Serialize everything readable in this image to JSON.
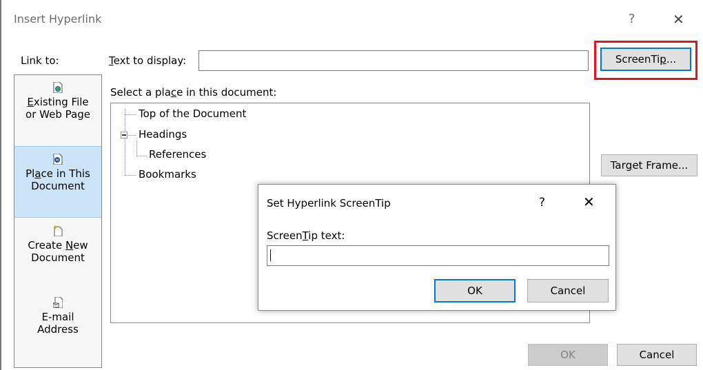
{
  "dialog": {
    "title": "Insert Hyperlink",
    "help_glyph": "?",
    "close_glyph": "✕"
  },
  "link_to": {
    "label": "Link to:",
    "items": [
      {
        "line1": "Existing File",
        "line2": "or Web Page",
        "icon": "document-globe-icon"
      },
      {
        "line1": "Place in This",
        "line2": "Document",
        "icon": "document-place-icon",
        "selected": true
      },
      {
        "line1": "Create New",
        "line2": "Document",
        "icon": "new-document-icon"
      },
      {
        "line1": "E-mail",
        "line2": "Address",
        "icon": "email-document-icon"
      }
    ]
  },
  "text_to_display": {
    "label": "Text to display:",
    "value": ""
  },
  "buttons": {
    "screentip": "ScreenTip...",
    "target_frame": "Target Frame...",
    "ok": "OK",
    "cancel": "Cancel"
  },
  "place": {
    "label": "Select a place in this document:",
    "tree": {
      "top": "Top of the Document",
      "headings": "Headings",
      "references": "References",
      "bookmarks": "Bookmarks"
    }
  },
  "screentip_dialog": {
    "title": "Set Hyperlink ScreenTip",
    "help_glyph": "?",
    "close_glyph": "✕",
    "label": "ScreenTip text:",
    "value": "",
    "ok": "OK",
    "cancel": "Cancel"
  },
  "colors": {
    "highlight_red": "#e81123",
    "focus_blue": "#0078d7",
    "selected_bg": "#cce4f7"
  }
}
